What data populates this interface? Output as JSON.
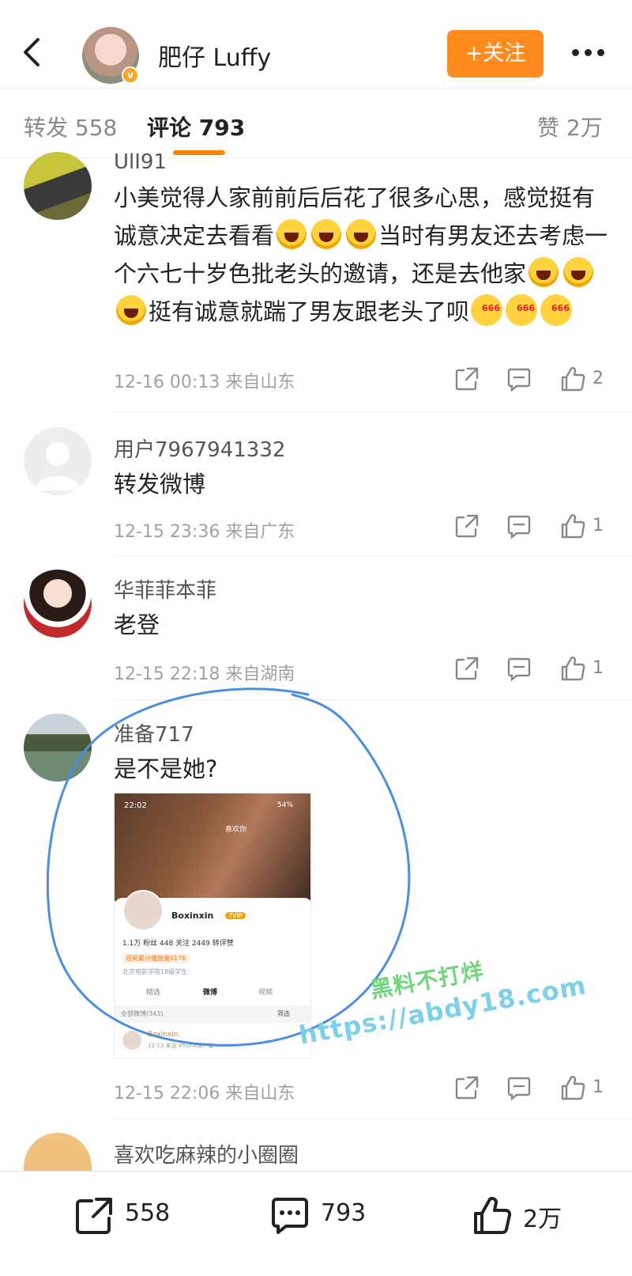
{
  "header": {
    "user_name": "肥仔 Luffy",
    "follow_label": "+关注"
  },
  "tabs": [
    {
      "label": "转发 558"
    },
    {
      "label": "评论 793"
    },
    {
      "label": "赞 2万"
    }
  ],
  "comments": [
    {
      "name": "UlI91",
      "text_parts": [
        "小美觉得人家前前后后花了很多心思，感觉挺有诚意决定去看看",
        "当时有男友还去考虑一个六七十岁色批老头的邀请，还是去他家",
        "挺有诚意就踹了男友跟老头了呗"
      ],
      "time": "12-16 00:13",
      "location": "来自山东",
      "likes": "2"
    },
    {
      "name": "用户7967941332",
      "text": "转发微博",
      "time": "12-15 23:36",
      "location": "来自广东",
      "likes": "1"
    },
    {
      "name": "华菲菲本菲",
      "text": "老登",
      "time": "12-15 22:18",
      "location": "来自湖南",
      "likes": "1"
    },
    {
      "name": "准备717",
      "text": "是不是她?",
      "time": "12-15 22:06",
      "location": "来自山东",
      "likes": "1",
      "image": {
        "status_time": "22:02",
        "battery": "54%",
        "like_label": "喜欢你",
        "profile_name": "Boxinxin",
        "vip_label": "7VIP",
        "stats": "1.1万 粉丝   448 关注   2449 转评赞",
        "tag": "视频累计播放量6176",
        "school": "北京电影学院18级学生",
        "tab1": "精选",
        "tab2": "微博",
        "tab3": "视频",
        "all_posts": "全部微博(343)",
        "filter": "筛选",
        "post_name": "Boxinxin",
        "post_time": "12-13  来自 iPhone客户端"
      }
    },
    {
      "name": "喜欢吃麻辣的小圈圈"
    }
  ],
  "watermark": {
    "line1": "黑料不打烊",
    "line2": "https://abdy18.com"
  },
  "bottom_bar": {
    "reposts": "558",
    "comments": "793",
    "likes": "2万"
  },
  "colors": {
    "accent": "#ff8200",
    "follow_bg": "#ff8a1e"
  }
}
